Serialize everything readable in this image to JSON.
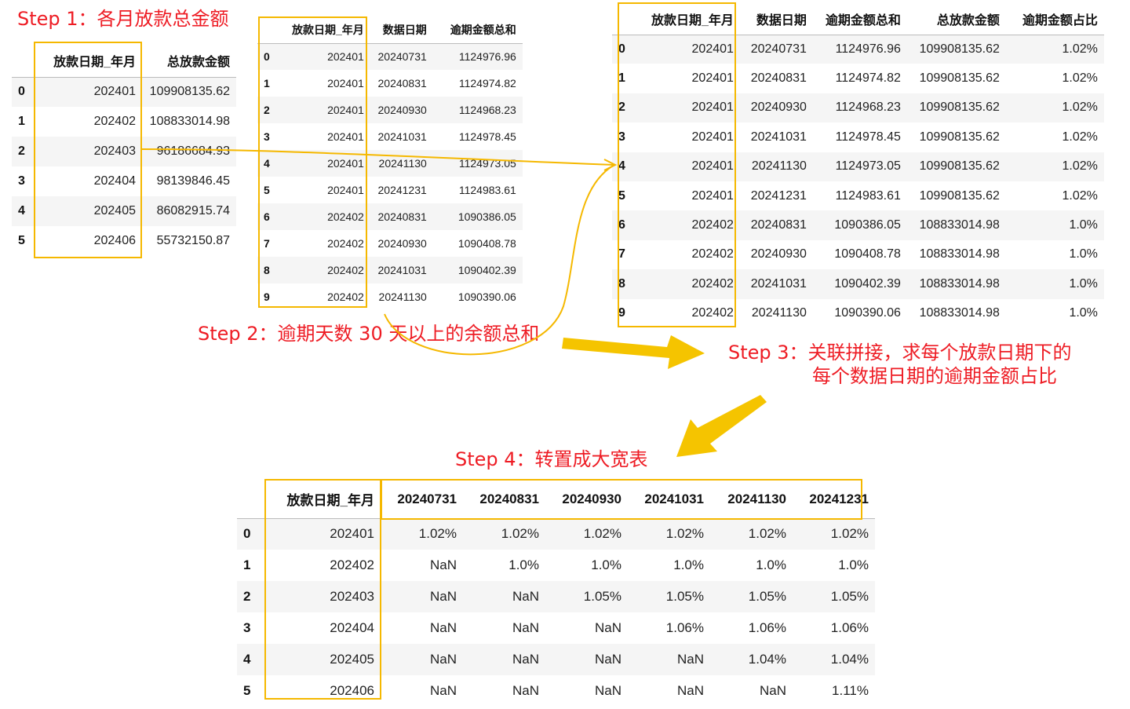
{
  "steps": {
    "step1": "Step 1：各月放款总金额",
    "step2": "Step 2：逾期天数 30 天以上的余额总和",
    "step3_line1": "Step 3：关联拼接，求每个放款日期下的",
    "step3_line2": "每个数据日期的逾期金额占比",
    "step4": "Step 4：转置成大宽表"
  },
  "table1": {
    "columns": [
      "",
      "放款日期_年月",
      "总放款金额"
    ],
    "rows": [
      [
        "0",
        "202401",
        "109908135.62"
      ],
      [
        "1",
        "202402",
        "108833014.98"
      ],
      [
        "2",
        "202403",
        "96186684.93"
      ],
      [
        "3",
        "202404",
        "98139846.45"
      ],
      [
        "4",
        "202405",
        "86082915.74"
      ],
      [
        "5",
        "202406",
        "55732150.87"
      ]
    ]
  },
  "table2": {
    "columns": [
      "",
      "放款日期_年月",
      "数据日期",
      "逾期金额总和"
    ],
    "rows": [
      [
        "0",
        "202401",
        "20240731",
        "1124976.96"
      ],
      [
        "1",
        "202401",
        "20240831",
        "1124974.82"
      ],
      [
        "2",
        "202401",
        "20240930",
        "1124968.23"
      ],
      [
        "3",
        "202401",
        "20241031",
        "1124978.45"
      ],
      [
        "4",
        "202401",
        "20241130",
        "1124973.05"
      ],
      [
        "5",
        "202401",
        "20241231",
        "1124983.61"
      ],
      [
        "6",
        "202402",
        "20240831",
        "1090386.05"
      ],
      [
        "7",
        "202402",
        "20240930",
        "1090408.78"
      ],
      [
        "8",
        "202402",
        "20241031",
        "1090402.39"
      ],
      [
        "9",
        "202402",
        "20241130",
        "1090390.06"
      ]
    ]
  },
  "table3": {
    "columns": [
      "",
      "放款日期_年月",
      "数据日期",
      "逾期金额总和",
      "总放款金额",
      "逾期金额占比"
    ],
    "rows": [
      [
        "0",
        "202401",
        "20240731",
        "1124976.96",
        "109908135.62",
        "1.02%"
      ],
      [
        "1",
        "202401",
        "20240831",
        "1124974.82",
        "109908135.62",
        "1.02%"
      ],
      [
        "2",
        "202401",
        "20240930",
        "1124968.23",
        "109908135.62",
        "1.02%"
      ],
      [
        "3",
        "202401",
        "20241031",
        "1124978.45",
        "109908135.62",
        "1.02%"
      ],
      [
        "4",
        "202401",
        "20241130",
        "1124973.05",
        "109908135.62",
        "1.02%"
      ],
      [
        "5",
        "202401",
        "20241231",
        "1124983.61",
        "109908135.62",
        "1.02%"
      ],
      [
        "6",
        "202402",
        "20240831",
        "1090386.05",
        "108833014.98",
        "1.0%"
      ],
      [
        "7",
        "202402",
        "20240930",
        "1090408.78",
        "108833014.98",
        "1.0%"
      ],
      [
        "8",
        "202402",
        "20241031",
        "1090402.39",
        "108833014.98",
        "1.0%"
      ],
      [
        "9",
        "202402",
        "20241130",
        "1090390.06",
        "108833014.98",
        "1.0%"
      ]
    ]
  },
  "table4": {
    "columns": [
      "",
      "放款日期_年月",
      "20240731",
      "20240831",
      "20240930",
      "20241031",
      "20241130",
      "20241231"
    ],
    "rows": [
      [
        "0",
        "202401",
        "1.02%",
        "1.02%",
        "1.02%",
        "1.02%",
        "1.02%",
        "1.02%"
      ],
      [
        "1",
        "202402",
        "NaN",
        "1.0%",
        "1.0%",
        "1.0%",
        "1.0%",
        "1.0%"
      ],
      [
        "2",
        "202403",
        "NaN",
        "NaN",
        "1.05%",
        "1.05%",
        "1.05%",
        "1.05%"
      ],
      [
        "3",
        "202404",
        "NaN",
        "NaN",
        "NaN",
        "1.06%",
        "1.06%",
        "1.06%"
      ],
      [
        "4",
        "202405",
        "NaN",
        "NaN",
        "NaN",
        "NaN",
        "1.04%",
        "1.04%"
      ],
      [
        "5",
        "202406",
        "NaN",
        "NaN",
        "NaN",
        "NaN",
        "NaN",
        "1.11%"
      ]
    ]
  },
  "colors": {
    "step_text": "#ee1c24",
    "highlight_box": "#f5b800",
    "connector": "#f5b800",
    "big_arrow": "#f5c400",
    "row_stripe": "#f5f5f5"
  }
}
